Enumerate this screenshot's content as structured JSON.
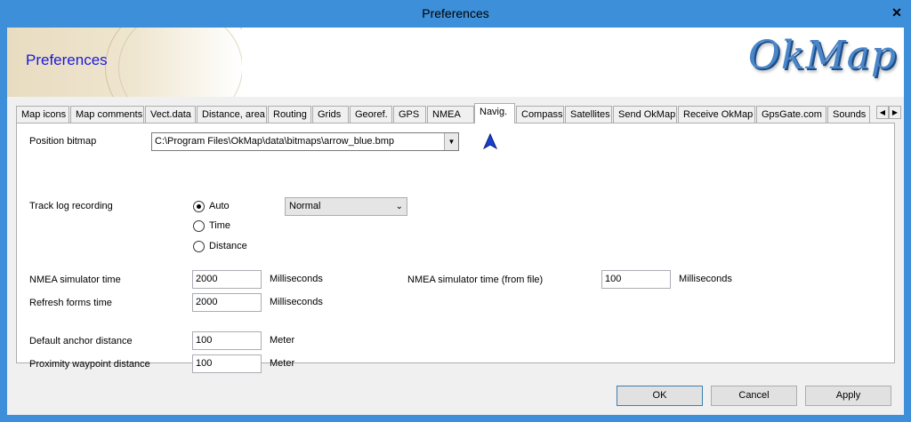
{
  "window": {
    "title": "Preferences",
    "close_label": "✕"
  },
  "banner": {
    "title": "Preferences",
    "logo": "OkMap"
  },
  "tabs": [
    {
      "label": "Map icons"
    },
    {
      "label": "Map comments"
    },
    {
      "label": "Vect.data"
    },
    {
      "label": "Distance, area"
    },
    {
      "label": "Routing"
    },
    {
      "label": "Grids"
    },
    {
      "label": "Georef."
    },
    {
      "label": "GPS"
    },
    {
      "label": "NMEA"
    },
    {
      "label": "Navig."
    },
    {
      "label": "Compass"
    },
    {
      "label": "Satellites"
    },
    {
      "label": "Send OkMap"
    },
    {
      "label": "Receive OkMap"
    },
    {
      "label": "GpsGate.com"
    },
    {
      "label": "Sounds"
    }
  ],
  "active_tab": "Navig.",
  "tab_scroll": {
    "left": "◀",
    "right": "▶"
  },
  "nav": {
    "position_bitmap_label": "Position bitmap",
    "position_bitmap_value": "C:\\Program Files\\OkMap\\data\\bitmaps\\arrow_blue.bmp",
    "track_log_label": "Track log recording",
    "track_options": [
      "Auto",
      "Time",
      "Distance"
    ],
    "track_selected": "Auto",
    "track_mode_value": "Normal",
    "nmea_sim_label": "NMEA simulator time",
    "nmea_sim_value": "2000",
    "nmea_sim_unit": "Milliseconds",
    "nmea_sim_file_label": "NMEA simulator time (from file)",
    "nmea_sim_file_value": "100",
    "nmea_sim_file_unit": "Milliseconds",
    "refresh_label": "Refresh forms time",
    "refresh_value": "2000",
    "refresh_unit": "Milliseconds",
    "anchor_label": "Default anchor distance",
    "anchor_value": "100",
    "anchor_unit": "Meter",
    "proximity_label": "Proximity waypoint distance",
    "proximity_value": "100",
    "proximity_unit": "Meter"
  },
  "buttons": {
    "ok": "OK",
    "cancel": "Cancel",
    "apply": "Apply"
  },
  "colors": {
    "titlebar": "#3c8fd8",
    "banner_title": "#1a1ad8",
    "arrow_icon": "#1a3fd0"
  }
}
